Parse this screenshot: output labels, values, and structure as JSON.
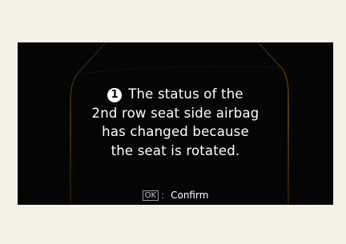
{
  "notice": {
    "icon_name": "info-number-1-icon",
    "icon_text": "1",
    "lines": [
      "The status of the",
      "2nd row seat side airbag",
      "has changed because",
      "the seat is rotated."
    ]
  },
  "footer": {
    "key_label": "OK",
    "separator": ":",
    "action_label": "Confirm"
  },
  "colors": {
    "page_background": "#f6f1e7",
    "screen_background": "#050505",
    "frame_accent": "#8a5a24",
    "text": "#ffffff"
  }
}
